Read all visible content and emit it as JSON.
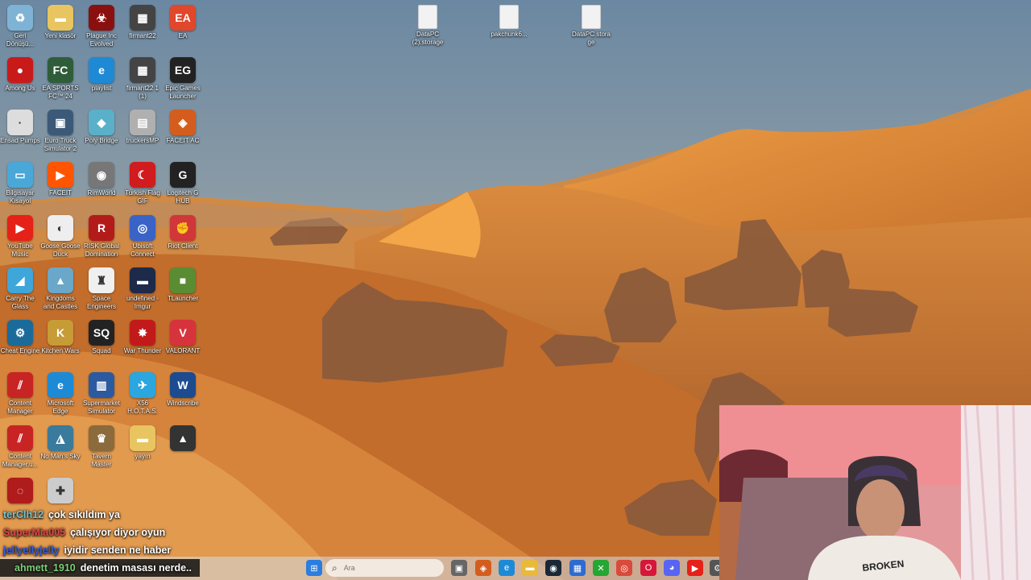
{
  "desktop": {
    "file_icons": [
      {
        "label": "DataPC (2).storage"
      },
      {
        "label": "pakchunk6..."
      },
      {
        "label": "DataPC.storage"
      }
    ],
    "icons": [
      {
        "label": "Geri Dönüşü...",
        "icon": "recycle-bin-icon",
        "color": "#7fb3d5",
        "glyph": "♻"
      },
      {
        "label": "Yeni klasör",
        "icon": "folder-icon",
        "color": "#e8c560",
        "glyph": "▬"
      },
      {
        "label": "Plague Inc Evolved",
        "icon": "plague-inc-icon",
        "color": "#8a1010",
        "glyph": "☣"
      },
      {
        "label": "firmant22",
        "icon": "video-file-icon",
        "color": "#444",
        "glyph": "▦"
      },
      {
        "label": "EA",
        "icon": "ea-icon",
        "color": "#e0472b",
        "glyph": "EA"
      },
      {
        "label": "Among Us",
        "icon": "among-us-icon",
        "color": "#c91a1a",
        "glyph": "●"
      },
      {
        "label": "EA SPORTS FC™ 24",
        "icon": "ea-fc-icon",
        "color": "#2f5d3a",
        "glyph": "FC"
      },
      {
        "label": "playlist",
        "icon": "edge-icon",
        "color": "#1e8ad6",
        "glyph": "e"
      },
      {
        "label": "firmant22 1 (1)",
        "icon": "video-file-icon",
        "color": "#444",
        "glyph": "▦"
      },
      {
        "label": "Epic Games Launcher",
        "icon": "epic-games-icon",
        "color": "#222",
        "glyph": "EG"
      },
      {
        "label": "Ensad Pumps",
        "icon": "blank-icon",
        "color": "#ddd",
        "glyph": "·"
      },
      {
        "label": "Euro Truck Simulator 2",
        "icon": "euro-truck-icon",
        "color": "#3c5a78",
        "glyph": "▣"
      },
      {
        "label": "Poly Bridge",
        "icon": "poly-bridge-icon",
        "color": "#5bb0c9",
        "glyph": "◆"
      },
      {
        "label": "truckersMP",
        "icon": "truckersmp-icon",
        "color": "#b0b0b0",
        "glyph": "▤"
      },
      {
        "label": "FACEIT AC",
        "icon": "faceit-ac-icon",
        "color": "#d45d1e",
        "glyph": "◈"
      },
      {
        "label": "Bilgisayar Kısayol",
        "icon": "computer-icon",
        "color": "#4aa8d8",
        "glyph": "▭"
      },
      {
        "label": "FACEIT",
        "icon": "faceit-icon",
        "color": "#ff5500",
        "glyph": "▶"
      },
      {
        "label": "RimWorld",
        "icon": "rimworld-icon",
        "color": "#777",
        "glyph": "◉"
      },
      {
        "label": "Turkish Flag GIF",
        "icon": "turkish-flag-icon",
        "color": "#d01c1f",
        "glyph": "☾"
      },
      {
        "label": "Logitech G HUB",
        "icon": "logitech-icon",
        "color": "#222",
        "glyph": "G"
      },
      {
        "label": "YouTube Music",
        "icon": "youtube-music-icon",
        "color": "#e62117",
        "glyph": "▶"
      },
      {
        "label": "Goose Goose Duck",
        "icon": "goose-icon",
        "color": "#eee",
        "glyph": "◐"
      },
      {
        "label": "RISK Global Domination",
        "icon": "risk-icon",
        "color": "#b31b1b",
        "glyph": "R"
      },
      {
        "label": "Ubisoft Connect",
        "icon": "ubisoft-icon",
        "color": "#3a63c7",
        "glyph": "◎"
      },
      {
        "label": "Riot Client",
        "icon": "riot-icon",
        "color": "#d13639",
        "glyph": "✊"
      },
      {
        "label": "Carry The Glass",
        "icon": "carry-glass-icon",
        "color": "#3fa6d9",
        "glyph": "◢"
      },
      {
        "label": "Kingdoms and Castles",
        "icon": "kingdoms-icon",
        "color": "#6aa7c9",
        "glyph": "▲"
      },
      {
        "label": "Space Engineers",
        "icon": "space-engineers-icon",
        "color": "#f0f0f0",
        "glyph": "♜"
      },
      {
        "label": "undefined - Imgur",
        "icon": "imgur-icon",
        "color": "#1e2a4a",
        "glyph": "▬"
      },
      {
        "label": "TLauncher",
        "icon": "tlauncher-icon",
        "color": "#5a8c33",
        "glyph": "■"
      },
      {
        "label": "Cheat Engine",
        "icon": "cheat-engine-icon",
        "color": "#1b6b9a",
        "glyph": "⚙"
      },
      {
        "label": "Kitchen Wars",
        "icon": "kitchen-wars-icon",
        "color": "#c79b35",
        "glyph": "K"
      },
      {
        "label": "Squad",
        "icon": "squad-icon",
        "color": "#222",
        "glyph": "SQ"
      },
      {
        "label": "War Thunder",
        "icon": "war-thunder-icon",
        "color": "#c21a1a",
        "glyph": "✸"
      },
      {
        "label": "VALORANT",
        "icon": "valorant-icon",
        "color": "#d7333d",
        "glyph": "V"
      },
      {
        "label": "Content Manager",
        "icon": "content-manager-icon",
        "color": "#c92424",
        "glyph": "⫽"
      },
      {
        "label": "Microsoft Edge",
        "icon": "edge-icon",
        "color": "#1e8ad6",
        "glyph": "e"
      },
      {
        "label": "Supermarket Simulator",
        "icon": "supermarket-icon",
        "color": "#2c5aa0",
        "glyph": "▥"
      },
      {
        "label": "X56 H.O.T.A.S.",
        "icon": "x56-icon",
        "color": "#2ba6de",
        "glyph": "✈"
      },
      {
        "label": "Windscribe",
        "icon": "windscribe-icon",
        "color": "#1d4b8f",
        "glyph": "W"
      },
      {
        "label": "Content Manager.u...",
        "icon": "content-manager-icon",
        "color": "#c92424",
        "glyph": "⫽"
      },
      {
        "label": "No Man's Sky",
        "icon": "no-mans-sky-icon",
        "color": "#3a7a9c",
        "glyph": "◮"
      },
      {
        "label": "Tavern Master",
        "icon": "tavern-master-icon",
        "color": "#8b6a3c",
        "glyph": "♛"
      },
      {
        "label": "yayın",
        "icon": "folder-icon",
        "color": "#e8c560",
        "glyph": "▬"
      },
      {
        "label": "",
        "icon": "game-icon",
        "color": "#333",
        "glyph": "▲"
      },
      {
        "label": "",
        "icon": "red-circle-icon",
        "color": "#b01b1b",
        "glyph": "◌"
      },
      {
        "label": "",
        "icon": "controller-icon",
        "color": "#ccc",
        "glyph": "✚"
      }
    ]
  },
  "chat": [
    {
      "user": "terClh12",
      "message": "çok sıkıldım ya",
      "color": "#6ec6d8"
    },
    {
      "user": "SuperMia005",
      "message": "çalışıyor diyor oyun",
      "color": "#e04848"
    },
    {
      "user": "jellyellyjelly",
      "message": "iyidir senden ne haber",
      "color": "#3a5fd8"
    },
    {
      "user": "ahmett_1910",
      "message": "denetim masası nerde..",
      "color": "#7dd07a"
    }
  ],
  "taskbar": {
    "search_placeholder": "Ara",
    "apps": [
      {
        "name": "start-button",
        "glyph": "⊞",
        "color": "#2b7de0"
      },
      {
        "name": "task-view-icon",
        "glyph": "▣",
        "color": "#666"
      },
      {
        "name": "faceit-ac-icon",
        "glyph": "◈",
        "color": "#d45d1e"
      },
      {
        "name": "edge-icon",
        "glyph": "e",
        "color": "#1e8ad6"
      },
      {
        "name": "file-explorer-icon",
        "glyph": "▬",
        "color": "#e8b93a"
      },
      {
        "name": "steam-icon",
        "glyph": "◉",
        "color": "#1b2838"
      },
      {
        "name": "xbox-icon",
        "glyph": "✕",
        "color": "#26a633"
      },
      {
        "name": "store-icon",
        "glyph": "▦",
        "color": "#2d6bd1"
      },
      {
        "name": "chrome-icon",
        "glyph": "◎",
        "color": "#d84b3a"
      },
      {
        "name": "opera-icon",
        "glyph": "O",
        "color": "#d6173a"
      },
      {
        "name": "discord-icon",
        "glyph": "◕",
        "color": "#5865f2"
      },
      {
        "name": "youtube-music-icon",
        "glyph": "▶",
        "color": "#e62117"
      },
      {
        "name": "settings-icon",
        "glyph": "⚙",
        "color": "#555"
      },
      {
        "name": "spotify-icon",
        "glyph": "♫",
        "color": "#1db954"
      }
    ]
  }
}
